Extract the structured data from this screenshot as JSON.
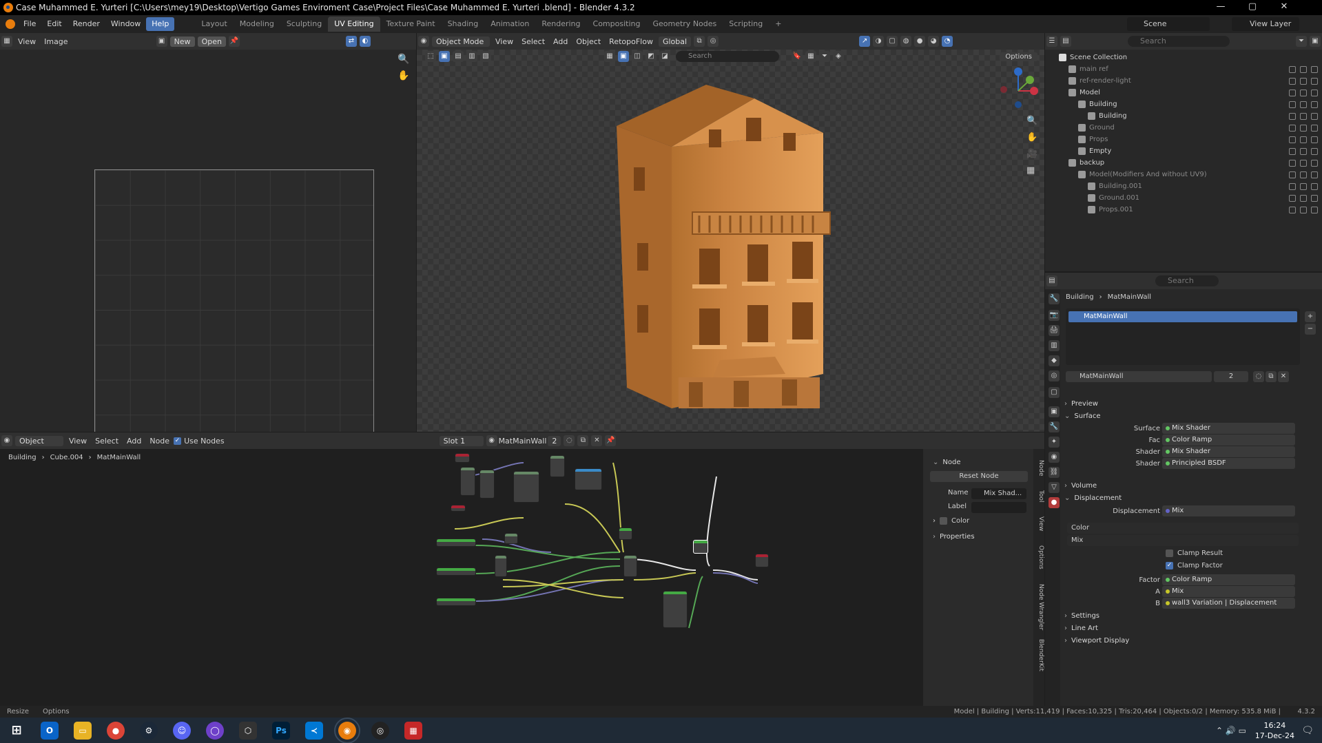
{
  "window": {
    "title": "Case Muhammed E. Yurteri  [C:\\Users\\mey19\\Desktop\\Vertigo Games Enviroment Case\\Project Files\\Case Muhammed E. Yurteri .blend] - Blender 4.3.2",
    "minimize": "—",
    "maximize": "▢",
    "close": "✕"
  },
  "menu": {
    "items": [
      "File",
      "Edit",
      "Render",
      "Window",
      "Help"
    ],
    "workspaces": [
      "Layout",
      "Modeling",
      "Sculpting",
      "UV Editing",
      "Texture Paint",
      "Shading",
      "Animation",
      "Rendering",
      "Compositing",
      "Geometry Nodes",
      "Scripting"
    ],
    "add_tab": "+",
    "scene_label": "Scene",
    "view_layer_label": "View Layer"
  },
  "uv_editor": {
    "view": "View",
    "image": "Image",
    "new": "New",
    "open": "Open"
  },
  "viewport": {
    "mode": "Object Mode",
    "menus": [
      "View",
      "Select",
      "Add",
      "Object"
    ],
    "retopoflow": "RetopoFlow",
    "transform": "Global",
    "search_placeholder": "Search",
    "options": "Options",
    "gizmo": {
      "x": "X",
      "y": "Y",
      "z": "Z"
    }
  },
  "outliner": {
    "search_placeholder": "Search",
    "root": "Scene Collection",
    "rows": [
      {
        "label": "main ref",
        "indent": 1,
        "dim": true
      },
      {
        "label": "ref-render-light",
        "indent": 1,
        "dim": true
      },
      {
        "label": "Model",
        "indent": 1,
        "dim": false
      },
      {
        "label": "Building",
        "indent": 2,
        "dim": false
      },
      {
        "label": "Building",
        "indent": 3,
        "dim": false
      },
      {
        "label": "Ground",
        "indent": 2,
        "dim": true
      },
      {
        "label": "Props",
        "indent": 2,
        "dim": true
      },
      {
        "label": "Empty",
        "indent": 2,
        "dim": false
      },
      {
        "label": "backup",
        "indent": 1,
        "dim": false
      },
      {
        "label": "Model(Modifiers And without UV9)",
        "indent": 2,
        "dim": true
      },
      {
        "label": "Building.001",
        "indent": 3,
        "dim": true
      },
      {
        "label": "Ground.001",
        "indent": 3,
        "dim": true
      },
      {
        "label": "Props.001",
        "indent": 3,
        "dim": true
      }
    ]
  },
  "properties": {
    "search_placeholder": "Search",
    "breadcrumb": [
      "Building",
      "MatMainWall"
    ],
    "slot_item": "MatMainWall",
    "material_name": "MatMainWall",
    "user_count": "2",
    "sections": {
      "preview": "Preview",
      "surface": "Surface",
      "volume": "Volume",
      "displacement": "Displacement",
      "settings": "Settings",
      "line_art": "Line Art",
      "viewport_display": "Viewport Display"
    },
    "surface_rows": [
      {
        "label": "Surface",
        "value": "Mix Shader",
        "color": "green"
      },
      {
        "label": "Fac",
        "value": "Color Ramp",
        "color": "green"
      },
      {
        "label": "Shader",
        "value": "Mix Shader",
        "color": "green"
      },
      {
        "label": "Shader",
        "value": "Principled BSDF",
        "color": "green"
      }
    ],
    "displacement_row": {
      "label": "Displacement",
      "value": "Mix",
      "color": "purple"
    },
    "dropdown_color": "Color",
    "dropdown_mix": "Mix",
    "clamp_result": "Clamp Result",
    "clamp_factor": "Clamp Factor",
    "mix_rows": [
      {
        "label": "Factor",
        "value": "Color Ramp",
        "color": "green"
      },
      {
        "label": "A",
        "value": "Mix",
        "color": "yellow"
      },
      {
        "label": "B",
        "value": "wall3 Variation | Displacement",
        "color": "yellow"
      }
    ]
  },
  "node_editor": {
    "object": "Object",
    "menus": [
      "View",
      "Select",
      "Add",
      "Node"
    ],
    "use_nodes": "Use Nodes",
    "slot": "Slot 1",
    "material": "MatMainWall",
    "users": "2",
    "breadcrumb": [
      "Building",
      "Cube.004",
      "MatMainWall"
    ],
    "panel": {
      "node_header": "Node",
      "reset": "Reset Node",
      "name_label": "Name",
      "name_value": "Mix Shad...",
      "label_label": "Label",
      "color": "Color",
      "properties": "Properties"
    },
    "side_tabs": [
      "Node",
      "Tool",
      "View",
      "Options",
      "Node Wrangler",
      "BlenderKit"
    ]
  },
  "statusbar": {
    "left": [
      "Resize",
      "Options"
    ],
    "right": "Model | Building | Verts:11,419 | Faces:10,325 | Tris:20,464 | Objects:0/2 | Memory: 535.8 MiB |",
    "version": "4.3.2"
  },
  "taskbar": {
    "time": "16:24",
    "date": "17-Dec-24",
    "apps": [
      "start-icon",
      "outlook-icon",
      "explorer-icon",
      "chrome-icon",
      "steam-icon",
      "discord-icon",
      "github-icon",
      "unity-icon",
      "photoshop-icon",
      "vscode-icon",
      "blender-icon",
      "search-app-icon",
      "app-icon"
    ],
    "ps_text": "Ps"
  },
  "colors": {
    "accent": "#4772b3",
    "building": "#d9914a",
    "blender_orange": "#e87d0d"
  }
}
